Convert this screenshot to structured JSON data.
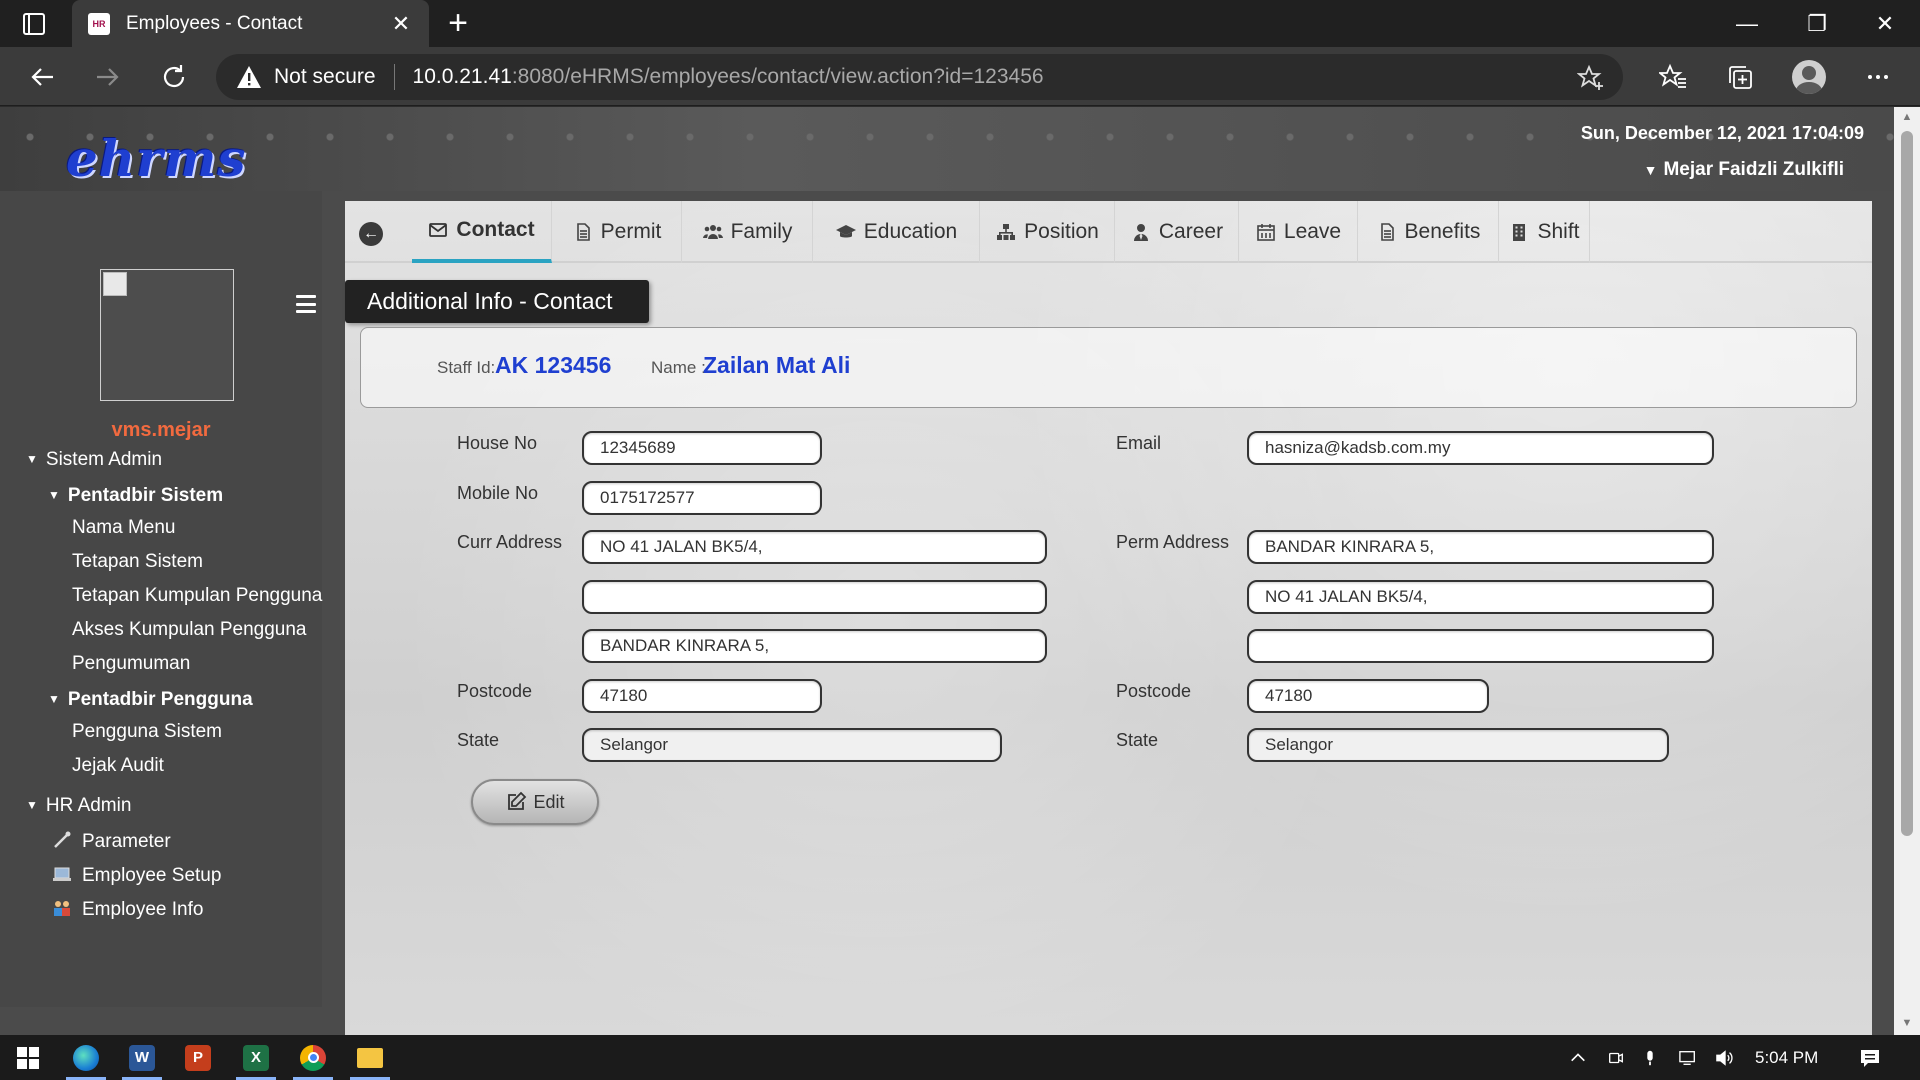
{
  "browser": {
    "tab_title": "Employees - Contact",
    "security_label": "Not secure",
    "url_host": "10.0.21.41",
    "url_path": ":8080/eHRMS/employees/contact/view.action?id=123456"
  },
  "header": {
    "logo_text": "ehrms",
    "datetime": "Sun, December 12, 2021 17:04:09",
    "user_name": "Mejar Faidzli Zulkifli"
  },
  "sidebar": {
    "username": "vms.mejar",
    "groups": [
      {
        "label": "Sistem Admin"
      },
      {
        "label": "Pentadbir Sistem"
      },
      {
        "label": "Pentadbir Pengguna"
      },
      {
        "label": "HR Admin"
      }
    ],
    "items": [
      {
        "label": "Nama Menu"
      },
      {
        "label": "Tetapan Sistem"
      },
      {
        "label": "Tetapan Kumpulan Pengguna"
      },
      {
        "label": "Akses Kumpulan Pengguna"
      },
      {
        "label": "Pengumuman"
      },
      {
        "label": "Pengguna Sistem"
      },
      {
        "label": "Jejak Audit"
      },
      {
        "label": "Parameter",
        "icon": "wrench-icon"
      },
      {
        "label": "Employee Setup",
        "icon": "laptop-icon"
      },
      {
        "label": "Employee Info",
        "icon": "people-icon"
      }
    ]
  },
  "tabs": [
    {
      "label": "Contact",
      "icon": "envelope-icon",
      "active": true
    },
    {
      "label": "Permit",
      "icon": "document-icon"
    },
    {
      "label": "Family",
      "icon": "users-icon"
    },
    {
      "label": "Education",
      "icon": "graduation-cap-icon"
    },
    {
      "label": "Position",
      "icon": "sitemap-icon"
    },
    {
      "label": "Career",
      "icon": "user-tie-icon"
    },
    {
      "label": "Leave",
      "icon": "calendar-icon"
    },
    {
      "label": "Benefits",
      "icon": "document-icon"
    },
    {
      "label": "Shift",
      "icon": "building-icon"
    }
  ],
  "section_title": "Additional Info - Contact",
  "staff": {
    "id_label": "Staff Id:",
    "id_value": "AK 123456",
    "name_label": "Name :",
    "name_value": "Zailan Mat Ali"
  },
  "form": {
    "house_no_label": "House No",
    "house_no": "12345689",
    "mobile_no_label": "Mobile No",
    "mobile_no": "0175172577",
    "curr_address_label": "Curr Address",
    "curr_address_1": "NO 41 JALAN BK5/4,",
    "curr_address_2": "",
    "curr_address_3": "BANDAR KINRARA 5,",
    "curr_postcode_label": "Postcode",
    "curr_postcode": "47180",
    "curr_state_label": "State",
    "curr_state": "Selangor",
    "email_label": "Email",
    "email": "hasniza@kadsb.com.my",
    "perm_address_label": "Perm Address",
    "perm_address_1": "BANDAR KINRARA 5,",
    "perm_address_2": "NO 41 JALAN BK5/4,",
    "perm_address_3": "",
    "perm_postcode_label": "Postcode",
    "perm_postcode": "47180",
    "perm_state_label": "State",
    "perm_state": "Selangor",
    "edit_label": "Edit"
  },
  "taskbar": {
    "clock": "5:04 PM",
    "apps": [
      "start-icon",
      "edge-icon",
      "word-icon",
      "powerpoint-icon",
      "excel-icon",
      "chrome-icon",
      "file-explorer-icon"
    ]
  },
  "colors": {
    "accent_blue": "#1f3fd0",
    "username_orange": "#f26a3f",
    "active_tab_underline": "#2aa3c2"
  }
}
